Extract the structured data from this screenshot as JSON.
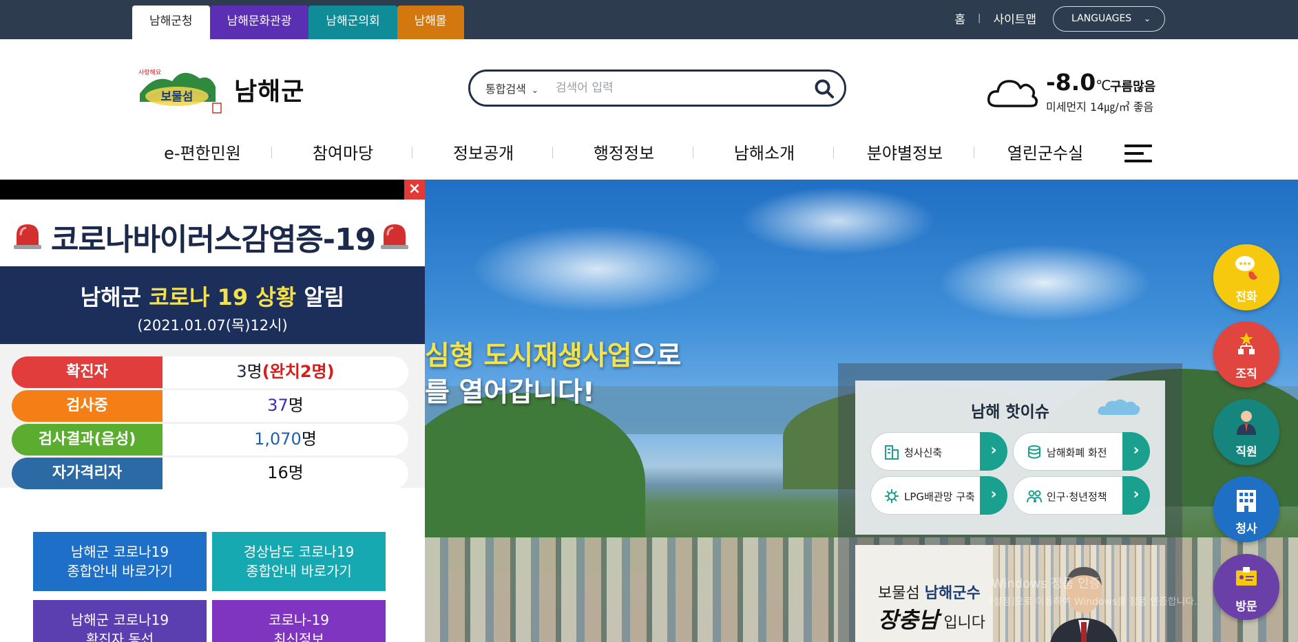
{
  "site_tabs": [
    "남해군청",
    "남해문화관광",
    "남해군의회",
    "남해몰"
  ],
  "util": {
    "home": "홈",
    "sitemap": "사이트맵",
    "languages": "LANGUAGES"
  },
  "header": {
    "logo_name": "남해군",
    "search": {
      "type": "통합검색",
      "placeholder": "검색어 입력"
    },
    "weather": {
      "temp": "-8.0",
      "unit": "℃",
      "sky": "구름많음",
      "dust": "미세먼지 14㎍/㎥ 좋음"
    }
  },
  "gnb": [
    "e-편한민원",
    "참여마당",
    "정보공개",
    "행정정보",
    "남해소개",
    "분야별정보",
    "열린군수실"
  ],
  "popup": {
    "headline": "코로나바이러스감염증-19",
    "title_pre": "남해군 ",
    "title_hl": "코로나 19 상황",
    "title_post": " 알림",
    "date": "(2021.01.07(목)12시)",
    "stats": [
      {
        "label": "확진자",
        "num": "3",
        "unit": "명",
        "extra_open": "(",
        "extra": "완치2명",
        "extra_close": ")"
      },
      {
        "label": "검사중",
        "num": "37",
        "unit": "명"
      },
      {
        "label": "검사결과(음성)",
        "num": "1,070",
        "unit": "명"
      },
      {
        "label": "자가격리자",
        "num": "16",
        "unit": "명"
      }
    ],
    "links": [
      [
        "남해군 코로나19",
        "종합안내 바로가기"
      ],
      [
        "경상남도 코로나19",
        "종합안내 바로가기"
      ],
      [
        "남해군 코로나19",
        "확진자 동선"
      ],
      [
        "코로나-19",
        "최신정보"
      ]
    ]
  },
  "hero": {
    "line1_hl": "심형 도시재생사업",
    "line1_post": "으로",
    "line2": "를 열어갑니다!"
  },
  "issue": {
    "title": "남해 핫이슈",
    "items": [
      "청사신축",
      "남해화폐 화전",
      "LPG배관망 구축",
      "인구·청년정책"
    ]
  },
  "mayor": {
    "pre": "보물섬 ",
    "bold": "남해군수",
    "name": "장충남",
    "post": " 입니다"
  },
  "quick": [
    "전화",
    "조직",
    "직원",
    "청사",
    "방문"
  ],
  "watermark": {
    "line1": "Windows 정품 인증",
    "line2": "[설정]으로 이동하여 Windows를 정품 인증합니다."
  },
  "colors": {
    "topbar": "#2d3d4f",
    "tab_culture": "#5a2fb4",
    "tab_council": "#0f8c97",
    "tab_mall": "#d3780f",
    "issue_accent": "#1aa08e"
  }
}
